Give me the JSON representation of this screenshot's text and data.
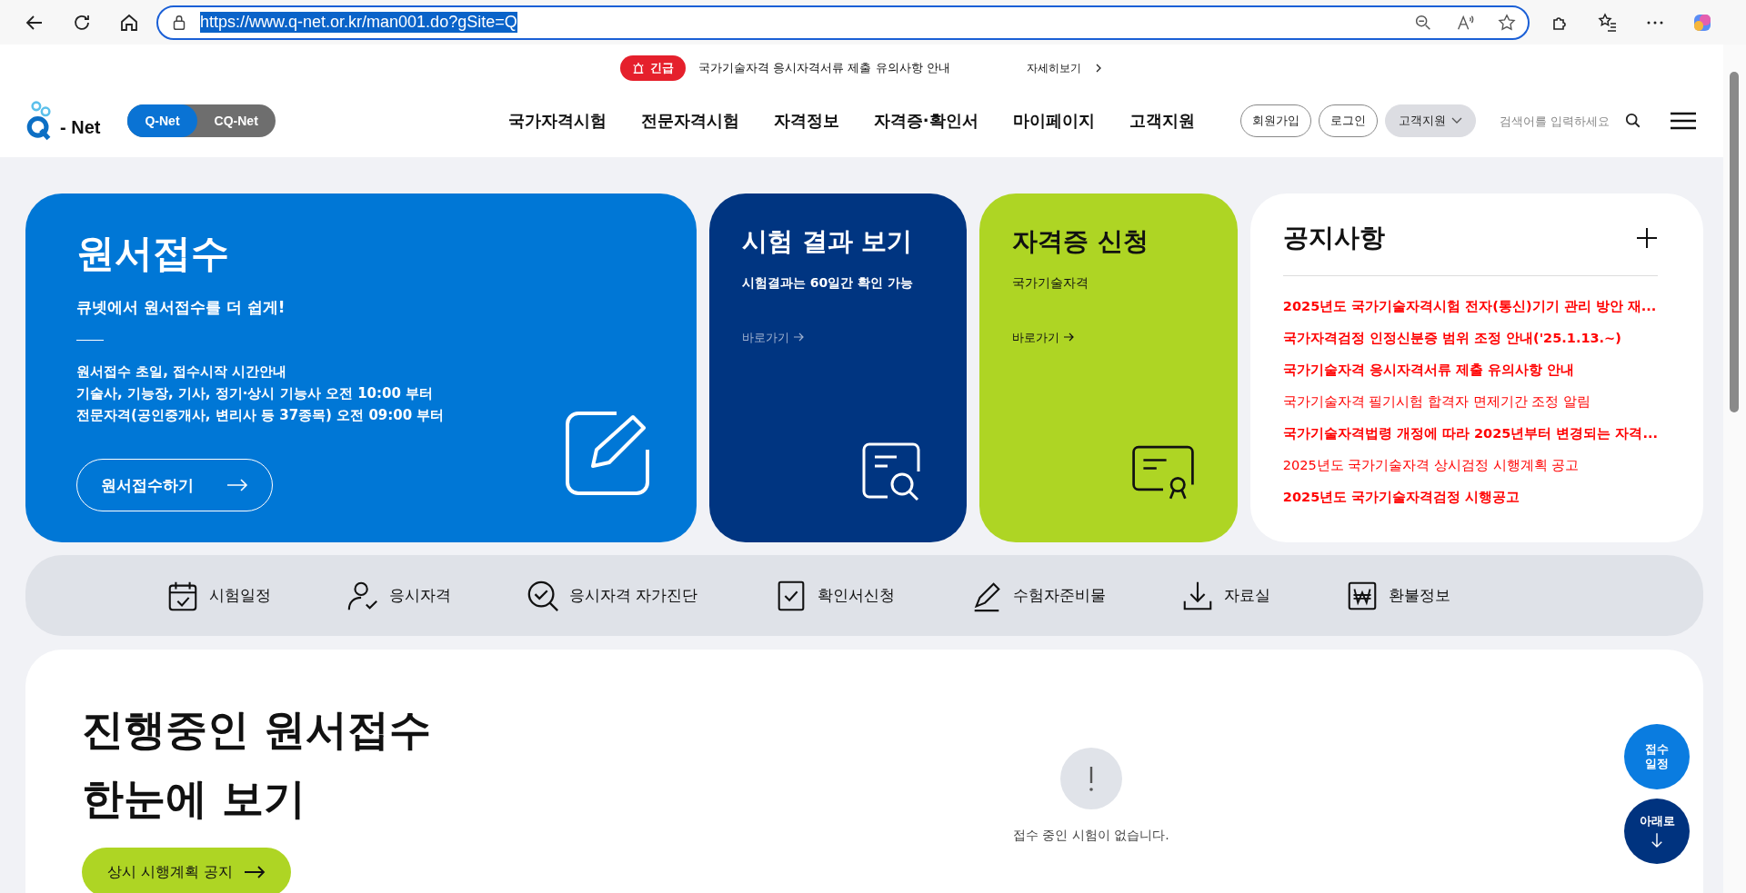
{
  "browser": {
    "url": "https://www.q-net.or.kr/man001.do?gSite=Q"
  },
  "alert": {
    "badge": "긴급",
    "text": "국가기술자격 응시자격서류 제출 유의사항 안내",
    "link": "자세히보기"
  },
  "header": {
    "logo_text": "- Net",
    "site_switch": [
      {
        "label": "Q-Net",
        "selected": true
      },
      {
        "label": "CQ-Net",
        "selected": false
      }
    ],
    "nav": [
      "국가자격시험",
      "전문자격시험",
      "자격정보",
      "자격증·확인서",
      "마이페이지",
      "고객지원"
    ],
    "buttons": [
      "회원가입",
      "로그인"
    ],
    "dropdown": "고객지원",
    "search": {
      "placeholder": "검색어를 입력하세요"
    }
  },
  "main_card": {
    "title": "원서접수",
    "subtitle": "큐넷에서 원서접수를 더 쉽게!",
    "lines": [
      "원서접수 초일, 접수시작 시간안내",
      "기술사, 기능장, 기사, 정기·상시 기능사 오전 10:00 부터",
      "전문자격(공인중개사, 변리사 등 37종목) 오전 09:00 부터"
    ],
    "button": "원서접수하기"
  },
  "cards": [
    {
      "title": "시험 결과 보기",
      "subtitle": "시험결과는 60일간 확인 가능",
      "link": "바로가기"
    },
    {
      "title": "자격증 신청",
      "subtitle": "국가기술자격",
      "link": "바로가기"
    }
  ],
  "notices": {
    "title": "공지사항",
    "items": [
      {
        "text": "2025년도 국가기술자격시험 전자(통신)기기 관리 방안 재...",
        "emphasis": true
      },
      {
        "text": "국가자격검정 인정신분증 범위 조정 안내('25.1.13.~)",
        "emphasis": true
      },
      {
        "text": "국가기술자격 응시자격서류 제출 유의사항 안내",
        "emphasis": true
      },
      {
        "text": "국가기술자격 필기시험 합격자 면제기간 조정 알림",
        "emphasis": false
      },
      {
        "text": "국가기술자격법령 개정에 따라 2025년부터 변경되는 자격...",
        "emphasis": true
      },
      {
        "text": "2025년도 국가기술자격 상시검정 시행계획 공고",
        "emphasis": false
      },
      {
        "text": "2025년도 국가기술자격검정 시행공고",
        "emphasis": true
      }
    ]
  },
  "quick_menu": [
    "시험일정",
    "응시자격",
    "응시자격 자가진단",
    "확인서신청",
    "수험자준비물",
    "자료실",
    "환불정보"
  ],
  "ongoing": {
    "title_lines": [
      "진행중인 원서접수",
      "한눈에 보기"
    ],
    "button": "상시 시행계획 공지",
    "empty_message": "접수 중인 시험이 없습니다."
  },
  "floating": [
    {
      "lines": [
        "접수",
        "일정"
      ]
    },
    {
      "lines": [
        "아래로"
      ]
    }
  ]
}
